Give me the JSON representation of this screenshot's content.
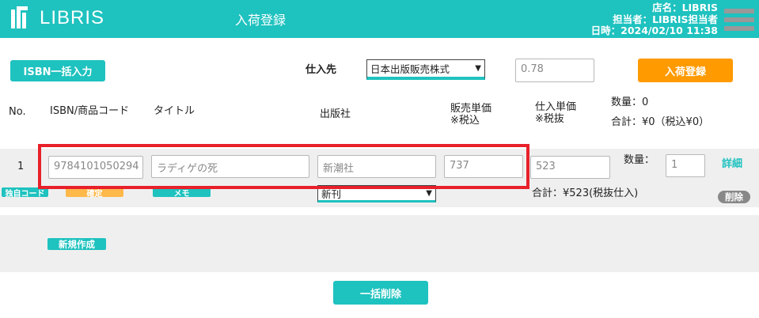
{
  "header": {
    "logo_text": "LIBRIS",
    "title": "入荷登録",
    "store": "店名：LIBRIS",
    "staff": "担当者：LIBRIS担当者",
    "datetime": "日時：2024/02/10 11:38",
    "colors": {
      "accent": "#1ec2bf",
      "orange": "#ff9a00",
      "highlight": "#e8202a"
    }
  },
  "toolbar": {
    "isbn_bulk_label": "ISBN一括入力",
    "supplier_label": "仕入先",
    "supplier_value": "日本出版販売株式",
    "rate_value": "0.78",
    "register_label": "入荷登録"
  },
  "table_header": {
    "no": "No.",
    "isbn": "ISBN/商品コード",
    "title": "タイトル",
    "publisher": "出版社",
    "sell_price_line1": "販売単価",
    "sell_price_line2": "※税込",
    "buy_price_line1": "仕入単価",
    "buy_price_line2": "※税抜",
    "quantity_summary": "数量：0",
    "total_summary": "合計：¥0（税込¥0）"
  },
  "row": {
    "no": "1",
    "isbn": "9784101050294",
    "title": "ラディゲの死",
    "publisher": "新潮社",
    "sell_price": "737",
    "buy_price": "523",
    "quantity_label": "数量：",
    "quantity": "1",
    "detail_link": "詳細",
    "own_code_badge": "独自コード",
    "confirm_badge": "確定",
    "memo_badge": "メモ",
    "condition_value": "新刊",
    "subtotal": "合計：¥523(税抜仕入)",
    "delete_label": "削除"
  },
  "new_section": {
    "create_label": "新規作成"
  },
  "footer": {
    "bulk_delete_label": "一括削除"
  }
}
